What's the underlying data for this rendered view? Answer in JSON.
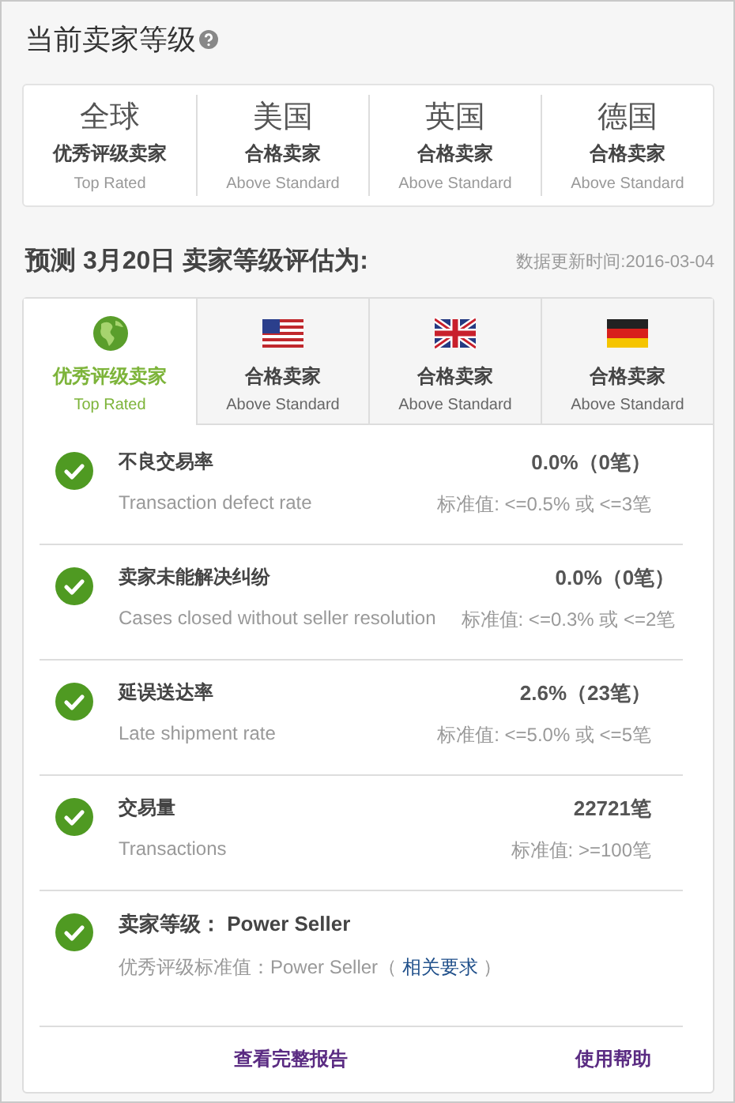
{
  "title": "当前卖家等级",
  "current_levels": [
    {
      "region": "全球",
      "level": "优秀评级卖家",
      "level_en": "Top Rated"
    },
    {
      "region": "美国",
      "level": "合格卖家",
      "level_en": "Above Standard"
    },
    {
      "region": "英国",
      "level": "合格卖家",
      "level_en": "Above Standard"
    },
    {
      "region": "德国",
      "level": "合格卖家",
      "level_en": "Above Standard"
    }
  ],
  "forecast": {
    "title": "预测 3月20日 卖家等级评估为:",
    "updated": "数据更新时间:2016-03-04"
  },
  "tabs": [
    {
      "kind": "globe",
      "level": "优秀评级卖家",
      "level_en": "Top Rated",
      "selected": true
    },
    {
      "kind": "us",
      "level": "合格卖家",
      "level_en": "Above Standard",
      "selected": false
    },
    {
      "kind": "uk",
      "level": "合格卖家",
      "level_en": "Above Standard",
      "selected": false
    },
    {
      "kind": "de",
      "level": "合格卖家",
      "level_en": "Above Standard",
      "selected": false
    }
  ],
  "metrics": [
    {
      "kind": "metric",
      "passed": true,
      "name": "不良交易率",
      "name_en": "Transaction defect rate",
      "value": "0.0%（0笔）",
      "standard": "标准值: <=0.5% 或 <=3笔"
    },
    {
      "kind": "metric",
      "passed": true,
      "name": "卖家未能解决纠纷",
      "name_en": "Cases closed without seller resolution",
      "value": "0.0%（0笔）",
      "standard": "标准值: <=0.3% 或 <=2笔"
    },
    {
      "kind": "metric",
      "passed": true,
      "name": "延误送达率",
      "name_en": "Late shipment rate",
      "value": "2.6%（23笔）",
      "standard": "标准值: <=5.0% 或 <=5笔"
    },
    {
      "kind": "metric",
      "passed": true,
      "name": "交易量",
      "name_en": "Transactions",
      "value": "22721笔",
      "standard": "标准值: >=100笔"
    },
    {
      "kind": "level",
      "passed": true,
      "name": "卖家等级： Power Seller",
      "note_prefix": "优秀评级标准值：Power Seller（ ",
      "link": "相关要求",
      "note_suffix": " ）"
    }
  ],
  "footer": {
    "report_link": "查看完整报告",
    "help_link": "使用帮助"
  }
}
